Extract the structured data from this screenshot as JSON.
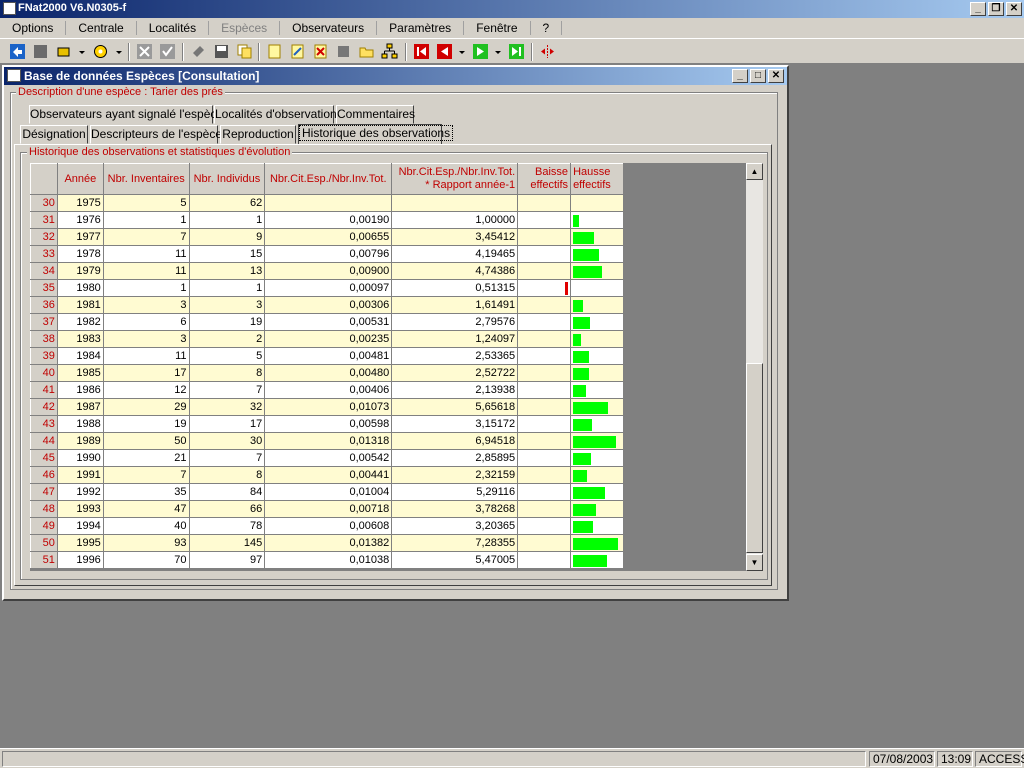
{
  "app": {
    "title": "FNat2000 V6.N0305-f"
  },
  "menu": [
    {
      "label": "Options",
      "enabled": true
    },
    {
      "label": "Centrale",
      "enabled": true
    },
    {
      "label": "Localités",
      "enabled": true
    },
    {
      "label": "Espèces",
      "enabled": false
    },
    {
      "label": "Observateurs",
      "enabled": true
    },
    {
      "label": "Paramètres",
      "enabled": true
    },
    {
      "label": "Fenêtre",
      "enabled": true
    },
    {
      "label": "?",
      "enabled": true
    }
  ],
  "window": {
    "title": "Base de données Espèces [Consultation]"
  },
  "species_group": {
    "label": "Description d'une espèce : Tarier des prés"
  },
  "tabs_row1": [
    {
      "label": "Observateurs ayant signalé l'espèce"
    },
    {
      "label": "Localités d'observation"
    },
    {
      "label": "Commentaires"
    }
  ],
  "tabs_row2": [
    {
      "label": "Désignation"
    },
    {
      "label": "Descripteurs de l'espèce"
    },
    {
      "label": "Reproduction"
    },
    {
      "label": "Historique des observations",
      "active": true
    }
  ],
  "history_group": {
    "label": "Historique des observations et statistiques d'évolution"
  },
  "grid": {
    "columns": [
      "",
      "Année",
      "Nbr. Inventaires",
      "Nbr. Individus",
      "Nbr.Cit.Esp./Nbr.Inv.Tot.",
      "Nbr.Cit.Esp./Nbr.Inv.Tot.\n* Rapport année-1",
      "Baisse\neffectifs",
      "Hausse\neffectifs"
    ],
    "rows": [
      {
        "n": "30",
        "annee": "1975",
        "inv": "5",
        "ind": "62",
        "ratio": "",
        "rapport": "",
        "baisse": 0,
        "hausse": 0
      },
      {
        "n": "31",
        "annee": "1976",
        "inv": "1",
        "ind": "1",
        "ratio": "0,00190",
        "rapport": "1,00000",
        "baisse": 0,
        "hausse": 1.0
      },
      {
        "n": "32",
        "annee": "1977",
        "inv": "7",
        "ind": "9",
        "ratio": "0,00655",
        "rapport": "3,45412",
        "baisse": 0,
        "hausse": 3.45412
      },
      {
        "n": "33",
        "annee": "1978",
        "inv": "11",
        "ind": "15",
        "ratio": "0,00796",
        "rapport": "4,19465",
        "baisse": 0,
        "hausse": 4.19465
      },
      {
        "n": "34",
        "annee": "1979",
        "inv": "11",
        "ind": "13",
        "ratio": "0,00900",
        "rapport": "4,74386",
        "baisse": 0,
        "hausse": 4.74386
      },
      {
        "n": "35",
        "annee": "1980",
        "inv": "1",
        "ind": "1",
        "ratio": "0,00097",
        "rapport": "0,51315",
        "baisse": 1,
        "hausse": 0
      },
      {
        "n": "36",
        "annee": "1981",
        "inv": "3",
        "ind": "3",
        "ratio": "0,00306",
        "rapport": "1,61491",
        "baisse": 0,
        "hausse": 1.61491
      },
      {
        "n": "37",
        "annee": "1982",
        "inv": "6",
        "ind": "19",
        "ratio": "0,00531",
        "rapport": "2,79576",
        "baisse": 0,
        "hausse": 2.79576
      },
      {
        "n": "38",
        "annee": "1983",
        "inv": "3",
        "ind": "2",
        "ratio": "0,00235",
        "rapport": "1,24097",
        "baisse": 0,
        "hausse": 1.24097
      },
      {
        "n": "39",
        "annee": "1984",
        "inv": "11",
        "ind": "5",
        "ratio": "0,00481",
        "rapport": "2,53365",
        "baisse": 0,
        "hausse": 2.53365
      },
      {
        "n": "40",
        "annee": "1985",
        "inv": "17",
        "ind": "8",
        "ratio": "0,00480",
        "rapport": "2,52722",
        "baisse": 0,
        "hausse": 2.52722
      },
      {
        "n": "41",
        "annee": "1986",
        "inv": "12",
        "ind": "7",
        "ratio": "0,00406",
        "rapport": "2,13938",
        "baisse": 0,
        "hausse": 2.13938
      },
      {
        "n": "42",
        "annee": "1987",
        "inv": "29",
        "ind": "32",
        "ratio": "0,01073",
        "rapport": "5,65618",
        "baisse": 0,
        "hausse": 5.65618
      },
      {
        "n": "43",
        "annee": "1988",
        "inv": "19",
        "ind": "17",
        "ratio": "0,00598",
        "rapport": "3,15172",
        "baisse": 0,
        "hausse": 3.15172
      },
      {
        "n": "44",
        "annee": "1989",
        "inv": "50",
        "ind": "30",
        "ratio": "0,01318",
        "rapport": "6,94518",
        "baisse": 0,
        "hausse": 6.94518
      },
      {
        "n": "45",
        "annee": "1990",
        "inv": "21",
        "ind": "7",
        "ratio": "0,00542",
        "rapport": "2,85895",
        "baisse": 0,
        "hausse": 2.85895
      },
      {
        "n": "46",
        "annee": "1991",
        "inv": "7",
        "ind": "8",
        "ratio": "0,00441",
        "rapport": "2,32159",
        "baisse": 0,
        "hausse": 2.32159
      },
      {
        "n": "47",
        "annee": "1992",
        "inv": "35",
        "ind": "84",
        "ratio": "0,01004",
        "rapport": "5,29116",
        "baisse": 0,
        "hausse": 5.29116
      },
      {
        "n": "48",
        "annee": "1993",
        "inv": "47",
        "ind": "66",
        "ratio": "0,00718",
        "rapport": "3,78268",
        "baisse": 0,
        "hausse": 3.78268
      },
      {
        "n": "49",
        "annee": "1994",
        "inv": "40",
        "ind": "78",
        "ratio": "0,00608",
        "rapport": "3,20365",
        "baisse": 0,
        "hausse": 3.20365
      },
      {
        "n": "50",
        "annee": "1995",
        "inv": "93",
        "ind": "145",
        "ratio": "0,01382",
        "rapport": "7,28355",
        "baisse": 0,
        "hausse": 7.28355
      },
      {
        "n": "51",
        "annee": "1996",
        "inv": "70",
        "ind": "97",
        "ratio": "0,01038",
        "rapport": "5,47005",
        "baisse": 0,
        "hausse": 5.47005
      }
    ]
  },
  "status": {
    "date": "07/08/2003",
    "time": "13:09",
    "db": "ACCESS"
  },
  "colors": {
    "header_text": "#c00000",
    "row_alt": "#fffbd2",
    "bar_up": "#00ff00",
    "bar_down": "#e00000",
    "title_bar": "#0a246a"
  }
}
